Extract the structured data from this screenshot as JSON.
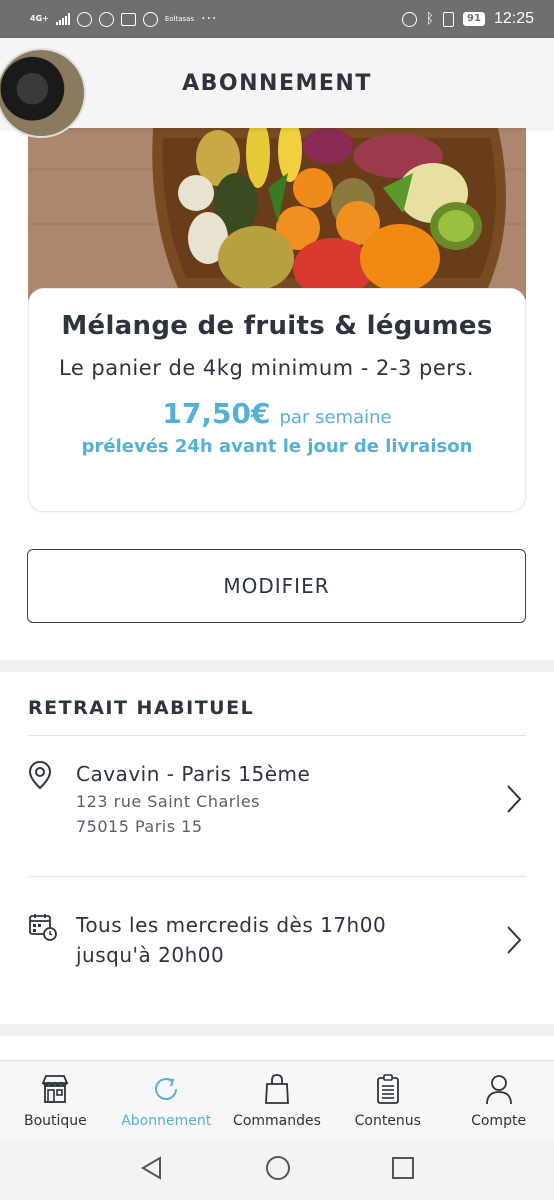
{
  "status_bar": {
    "network": "4G+",
    "small_text": "Eoltasas",
    "battery": "91",
    "time": "12:25"
  },
  "header": {
    "title": "ABONNEMENT"
  },
  "subscription": {
    "product_name": "Mélange de fruits & légumes",
    "description": "Le panier de 4kg minimum - 2-3 pers.",
    "price": "17,50€",
    "price_unit": "par semaine",
    "price_note": "prélevés 24h avant le jour de livraison",
    "modify_label": "MODIFIER"
  },
  "pickup": {
    "section_title": "RETRAIT HABITUEL",
    "location_name": "Cavavin - Paris 15ème",
    "address_line1": "123 rue Saint Charles",
    "address_line2": "75015 Paris 15",
    "schedule": "Tous les mercredis dès 17h00 jusqu'à 20h00"
  },
  "bottom_nav": {
    "items": [
      {
        "label": "Boutique",
        "icon": "shop-icon"
      },
      {
        "label": "Abonnement",
        "icon": "refresh-icon",
        "active": true
      },
      {
        "label": "Commandes",
        "icon": "bag-icon"
      },
      {
        "label": "Contenus",
        "icon": "clipboard-icon"
      },
      {
        "label": "Compte",
        "icon": "user-icon"
      }
    ]
  },
  "colors": {
    "accent": "#56b0d6",
    "text": "#2c3440",
    "status_bar": "#6f6f70"
  }
}
